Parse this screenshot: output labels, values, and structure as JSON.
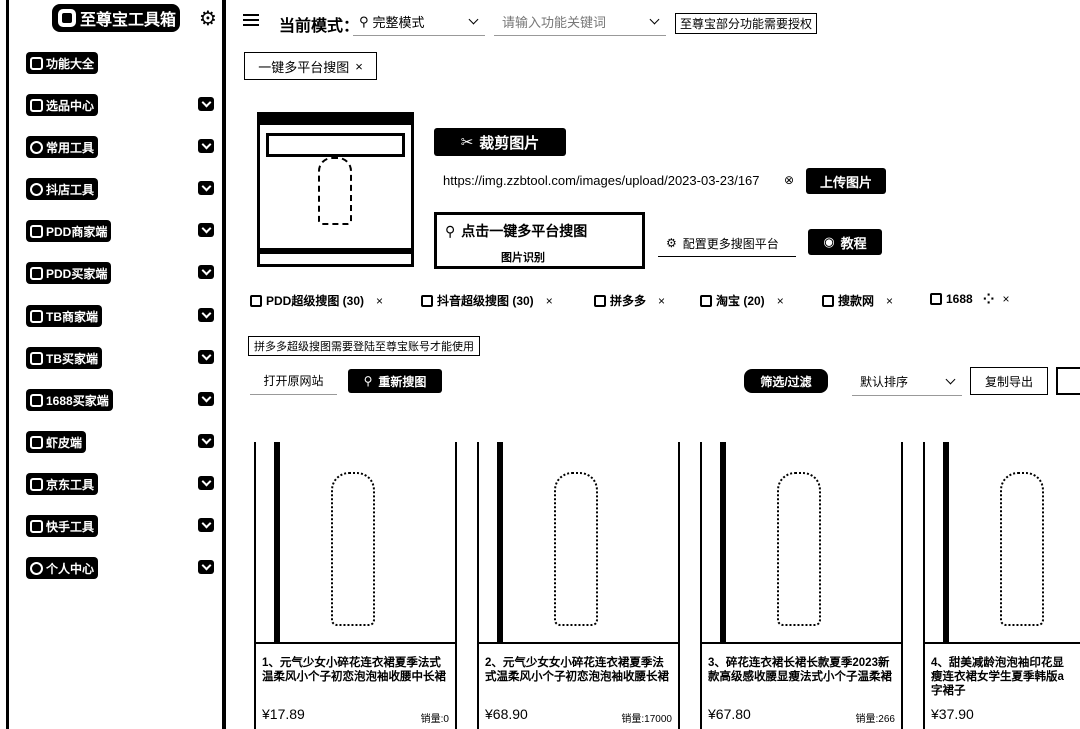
{
  "app": {
    "title": "至尊宝工具箱"
  },
  "sidebar": {
    "items": [
      {
        "label": "功能大全"
      },
      {
        "label": "选品中心"
      },
      {
        "label": "常用工具"
      },
      {
        "label": "抖店工具"
      },
      {
        "label": "PDD商家端"
      },
      {
        "label": "PDD买家端"
      },
      {
        "label": "TB商家端"
      },
      {
        "label": "TB买家端"
      },
      {
        "label": "1688买家端"
      },
      {
        "label": "虾皮端"
      },
      {
        "label": "京东工具"
      },
      {
        "label": "快手工具"
      },
      {
        "label": "个人中心"
      }
    ]
  },
  "header": {
    "mode_label": "当前模式：",
    "mode_value": "完整模式",
    "keyword_placeholder": "请输入功能关键词",
    "notice": "至尊宝部分功能需要授权"
  },
  "tabs": [
    {
      "label": "一键多平台搜图"
    }
  ],
  "search": {
    "crop_button": "裁剪图片",
    "image_url": "https://img.zzbtool.com/images/upload/2023-03-23/167",
    "upload_button": "上传图片",
    "search_button": "点击一键多平台搜图",
    "search_button_sub": "图片识别",
    "config_button": "配置更多搜图平台",
    "tutorial_button": "教程"
  },
  "platforms": [
    {
      "label": "PDD超级搜图 (30)"
    },
    {
      "label": "抖音超级搜图 (30)"
    },
    {
      "label": "拼多多"
    },
    {
      "label": "淘宝 (20)"
    },
    {
      "label": "搜款网"
    },
    {
      "label": "1688"
    }
  ],
  "login_notice": "拼多多超级搜图需要登陆至尊宝账号才能使用",
  "toolbar": {
    "open_site": "打开原网站",
    "research": "重新搜图",
    "filter": "筛选/过滤",
    "sort_value": "默认排序",
    "export": "复制导出"
  },
  "results": [
    {
      "title": "1、元气少女小碎花连衣裙夏季法式温柔风小个子初恋泡泡袖收腰中长裙",
      "price": "¥17.89",
      "sales": "销量:0"
    },
    {
      "title": "2、元气少女女小碎花连衣裙夏季法式温柔风小个子初恋泡泡袖收腰长裙",
      "price": "¥68.90",
      "sales": "销量:17000"
    },
    {
      "title": "3、碎花连衣裙长裙长款夏季2023新款高级感收腰显瘦法式小个子温柔裙",
      "price": "¥67.80",
      "sales": "销量:266"
    },
    {
      "title": "4、甜美减龄泡泡袖印花显瘦连衣裙女学生夏季韩版a字裙子",
      "price": "¥37.90",
      "sales": ""
    }
  ],
  "colors": {
    "primary": "#000000",
    "background": "#ffffff"
  }
}
